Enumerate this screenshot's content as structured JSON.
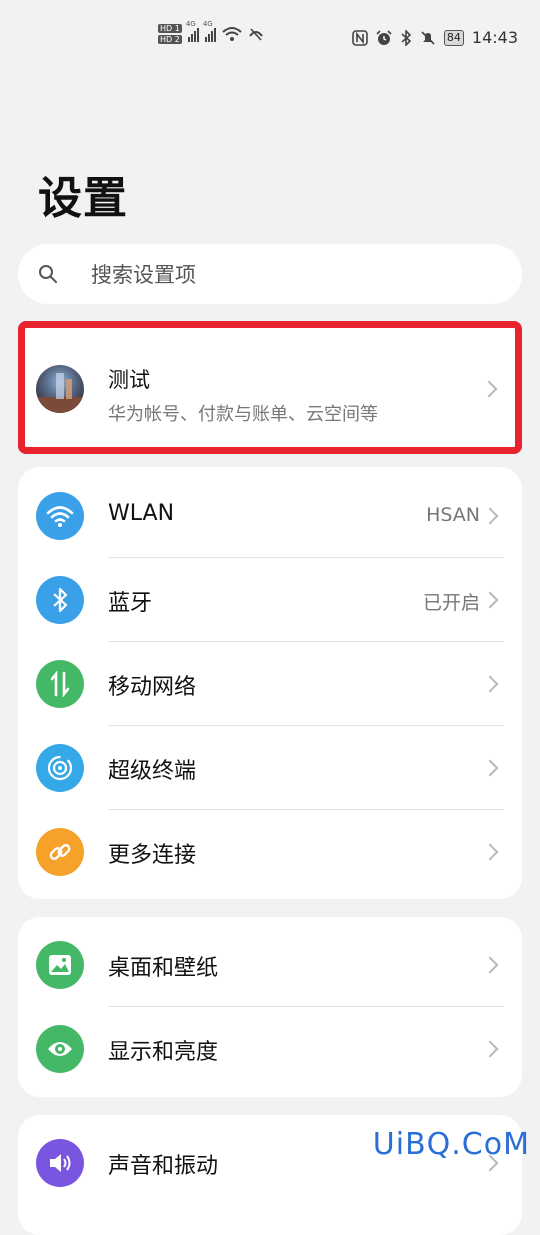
{
  "status_bar": {
    "sim1": "HD 1",
    "sim2": "HD 2",
    "network1": "4G",
    "network2": "4G",
    "battery": "84",
    "time": "14:43",
    "icons": [
      "nfc-icon",
      "alarm-icon",
      "bluetooth-icon",
      "mute-icon"
    ]
  },
  "page": {
    "title": "设置"
  },
  "search": {
    "placeholder": "搜索设置项"
  },
  "account": {
    "name": "测试",
    "subtitle": "华为帐号、付款与账单、云空间等",
    "highlight_color": "#e8232d"
  },
  "group1": [
    {
      "label": "WLAN",
      "value": "HSAN",
      "icon": "wifi-icon",
      "color": "#3aa0e8"
    },
    {
      "label": "蓝牙",
      "value": "已开启",
      "icon": "bluetooth-icon",
      "color": "#3aa0e8"
    },
    {
      "label": "移动网络",
      "value": "",
      "icon": "mobile-data-icon",
      "color": "#45b868"
    },
    {
      "label": "超级终端",
      "value": "",
      "icon": "super-device-icon",
      "color": "#35a8e8"
    },
    {
      "label": "更多连接",
      "value": "",
      "icon": "link-icon",
      "color": "#f5a12a"
    }
  ],
  "group2": [
    {
      "label": "桌面和壁纸",
      "icon": "wallpaper-icon",
      "color": "#45b868"
    },
    {
      "label": "显示和亮度",
      "icon": "eye-icon",
      "color": "#45b868"
    }
  ],
  "group3": [
    {
      "label": "声音和振动",
      "icon": "sound-icon",
      "color": "#7a55e0"
    }
  ],
  "watermark": "UiBQ.CoM"
}
